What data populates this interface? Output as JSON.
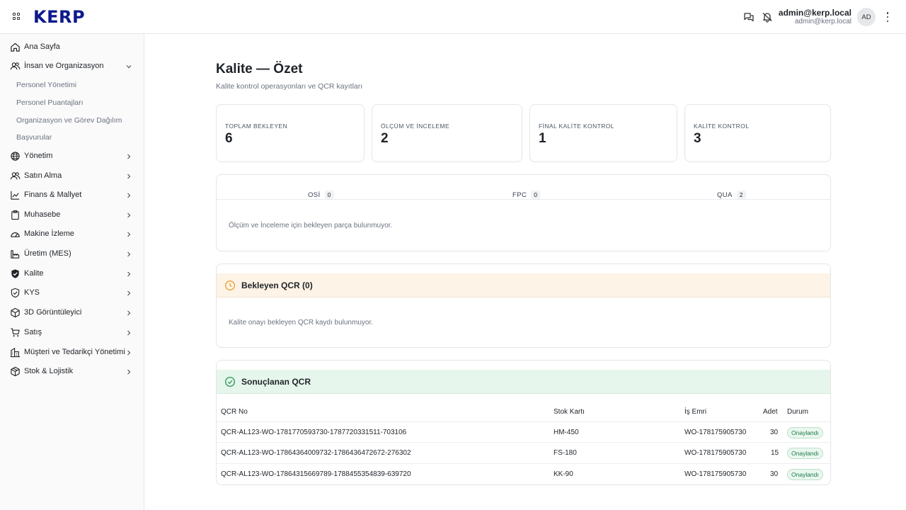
{
  "header": {
    "logo": "KERP",
    "user_name": "admin@kerp.local",
    "user_email": "admin@kerp.local",
    "avatar_initials": "AD"
  },
  "sidebar": {
    "items": [
      {
        "label": "Ana Sayfa",
        "icon": "home-icon"
      },
      {
        "label": "İnsan ve Organizasyon",
        "icon": "users-icon",
        "expanded": true
      },
      {
        "label": "Yönetim",
        "icon": "globe-icon"
      },
      {
        "label": "Satın Alma",
        "icon": "users-icon"
      },
      {
        "label": "Finans & Mallyet",
        "icon": "chart-icon"
      },
      {
        "label": "Muhasebe",
        "icon": "clipboard-icon"
      },
      {
        "label": "Makine İzleme",
        "icon": "gauge-icon"
      },
      {
        "label": "Üretim (MES)",
        "icon": "factory-icon"
      },
      {
        "label": "Kalite",
        "icon": "shield-check-icon"
      },
      {
        "label": "KYS",
        "icon": "shield-outline-icon"
      },
      {
        "label": "3D Görüntüleyici",
        "icon": "cube-icon"
      },
      {
        "label": "Satış",
        "icon": "cart-icon"
      },
      {
        "label": "Müşteri ve Tedarikçi Yönetimi",
        "icon": "building-icon"
      },
      {
        "label": "Stok & Lojistik",
        "icon": "package-icon"
      }
    ],
    "sub_items": [
      "Personel Yönetimi",
      "Personel Puantajları",
      "Organizasyon ve Görev Dağılımı",
      "Başvurular"
    ]
  },
  "main": {
    "title": "Kalite — Özet",
    "subtitle": "Kalite kontrol operasyonları ve QCR kayıtları",
    "stats": [
      {
        "label": "TOPLAM BEKLEYEN",
        "value": "6"
      },
      {
        "label": "ÖLÇÜM VE İNCELEME",
        "value": "2"
      },
      {
        "label": "FİNAL KALİTE KONTROL",
        "value": "1"
      },
      {
        "label": "KALİTE KONTROL",
        "value": "3"
      }
    ],
    "tabs": [
      {
        "label": "OSİ",
        "count": "0"
      },
      {
        "label": "FPC",
        "count": "0"
      },
      {
        "label": "QUA",
        "count": "2"
      }
    ],
    "tabs_empty": "Ölçüm ve İnceleme için bekleyen parça bulunmuyor.",
    "pending": {
      "title": "Bekleyen QCR (0)",
      "empty": "Kalite onayı bekleyen QCR kaydı bulunmuyor."
    },
    "completed": {
      "title": "Sonuçlanan QCR",
      "columns": [
        "QCR No",
        "Stok Kartı",
        "İş Emri",
        "Adet",
        "Durum"
      ],
      "rows": [
        {
          "qcr": "QCR-AL123-WO-1781770593730-1787720331511-703106",
          "stock": "HM-450",
          "order": "WO-178175905730",
          "qty": "30",
          "status": "Onaylandı"
        },
        {
          "qcr": "QCR-AL123-WO-17864364009732-1786436472672-276302",
          "stock": "FS-180",
          "order": "WO-178175905730",
          "qty": "15",
          "status": "Onaylandı"
        },
        {
          "qcr": "QCR-AL123-WO-17864315669789-1788455354839-639720",
          "stock": "KK-90",
          "order": "WO-178175905730",
          "qty": "30",
          "status": "Onaylandı"
        }
      ]
    }
  },
  "colors": {
    "logo": "#0d1a8c",
    "pending_band": "#fdf3e6",
    "pending_icon": "#e8a33d",
    "completed_band": "#e6f6ec",
    "completed_icon": "#2e9e5e",
    "badge_text": "#1b7a4a"
  }
}
